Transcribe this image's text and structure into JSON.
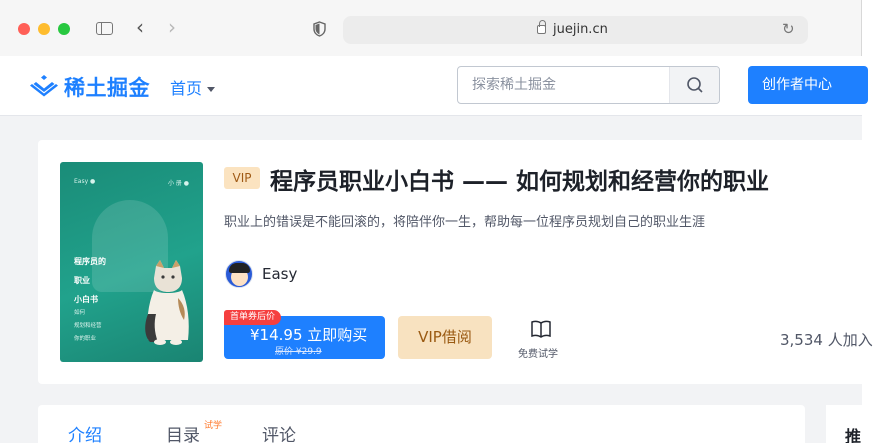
{
  "browser": {
    "url": "juejin.cn"
  },
  "header": {
    "logo_text": "稀土掘金",
    "nav_home": "首页",
    "search_placeholder": "探索稀土掘金",
    "creator_button": "创作者中心"
  },
  "book": {
    "cover": {
      "top_left": "Easy ●",
      "top_right": "小 册 ●",
      "lines": [
        "程序员的",
        "职业",
        "小白书"
      ],
      "sub_lines": [
        "如何",
        "规划和经营",
        "你的职业"
      ]
    },
    "vip_tag": "VIP",
    "title": "程序员职业小白书 —— 如何规划和经营你的职业",
    "description": "职业上的错误是不能回滚的，将陪伴你一生，帮助每一位程序员规划自己的职业生涯",
    "author": "Easy",
    "buy": {
      "coupon": "首单券后价",
      "main": "¥14.95 立即购买",
      "original": "原价 ¥29.9"
    },
    "vip_borrow": "VIP借阅",
    "trial_label": "免费试学",
    "joined": "3,534 人加入"
  },
  "tabs": [
    {
      "label": "介绍",
      "active": true
    },
    {
      "label": "目录",
      "badge": "试学"
    },
    {
      "label": "评论"
    }
  ],
  "sidebar": {
    "title": "推"
  },
  "colors": {
    "brand": "#1e80ff",
    "vip_gold": "#f8e2c0",
    "cover_green": "#21a28c"
  }
}
